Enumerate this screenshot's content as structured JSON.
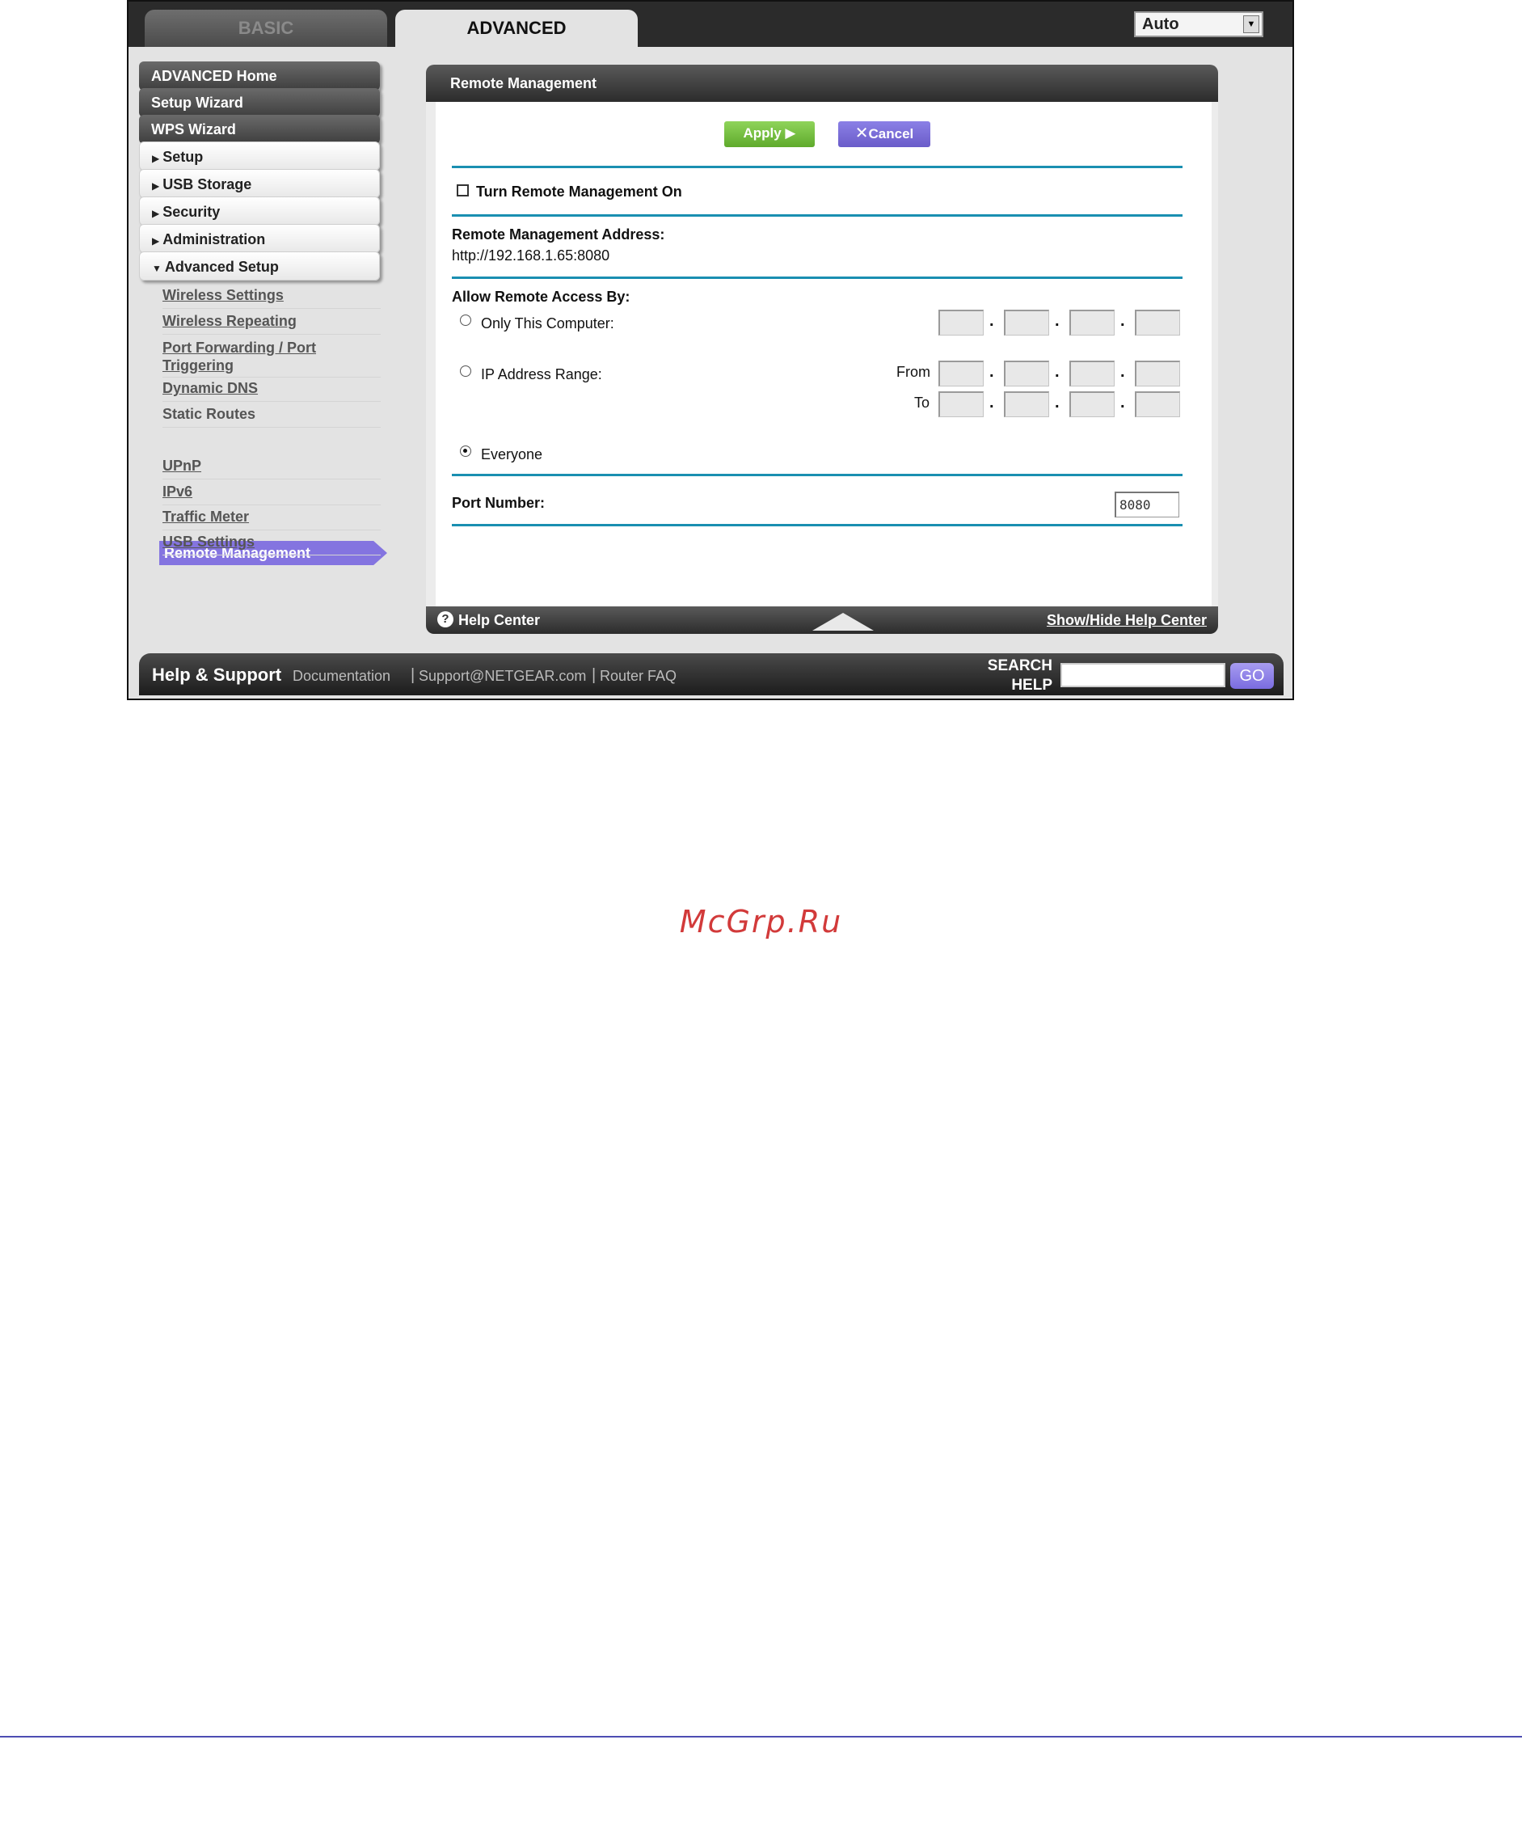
{
  "tabs": {
    "basic": "BASIC",
    "advanced": "ADVANCED"
  },
  "language": {
    "selected": "Auto"
  },
  "sidebar": {
    "main_buttons": [
      "ADVANCED Home",
      "Setup Wizard",
      "WPS Wizard"
    ],
    "sections": [
      "Setup",
      "USB Storage",
      "Security",
      "Administration",
      "Advanced Setup"
    ],
    "advanced_setup_items": [
      "Wireless Settings",
      "Wireless Repeating",
      "Port Forwarding / Port Triggering",
      "Dynamic DNS",
      "Static Routes",
      "Remote Management",
      "UPnP",
      "IPv6",
      "Traffic Meter",
      "USB Settings"
    ],
    "active_item": "Remote Management"
  },
  "panel": {
    "title": "Remote Management",
    "apply_label": "Apply ▶",
    "cancel_label": "Cancel",
    "turn_on_label": "Turn Remote Management On",
    "address_label": "Remote Management Address:",
    "address_value": "http://192.168.1.65:8080",
    "allow_label": "Allow Remote Access By:",
    "only_this_computer": "Only This Computer:",
    "ip_range": "IP Address Range:",
    "from_label": "From",
    "to_label": "To",
    "everyone": "Everyone",
    "selected_access": "Everyone",
    "remote_enabled": false,
    "port_label": "Port Number:",
    "port_value": "8080"
  },
  "help_center": {
    "label": "Help Center",
    "toggle_label": "Show/Hide Help Center"
  },
  "help_support": {
    "title": "Help & Support",
    "links": [
      "Documentation",
      "Support@NETGEAR.com",
      "Router FAQ"
    ],
    "search_label_1": "SEARCH",
    "search_label_2": "HELP",
    "go_label": "GO"
  },
  "watermark": "McGrp.Ru",
  "colors": {
    "accent_purple": "#8474e0",
    "apply_green": "#6fbf3a",
    "rule_blue": "#1a8fb1",
    "watermark_red": "#d23a3a"
  }
}
